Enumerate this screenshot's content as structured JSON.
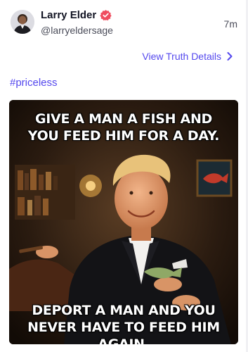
{
  "post": {
    "author": {
      "display_name": "Larry Elder",
      "handle": "@larryeldersage",
      "verified_icon": "verified-badge-icon",
      "avatar_icon": "avatar"
    },
    "timestamp": "7m",
    "details_link": {
      "label": "View Truth Details",
      "icon": "chevron-right-icon"
    },
    "hashtag": "#priceless",
    "media": {
      "top_text": "GIVE A MAN A FISH AND YOU FEED HIM FOR A DAY.",
      "bottom_text": "DEPORT A MAN AND YOU NEVER HAVE TO FEED HIM AGAIN."
    }
  },
  "colors": {
    "accent": "#5448ee",
    "verified_badge": "#ef4c5e",
    "text_primary": "#111322",
    "text_secondary": "#4b4d5a"
  }
}
